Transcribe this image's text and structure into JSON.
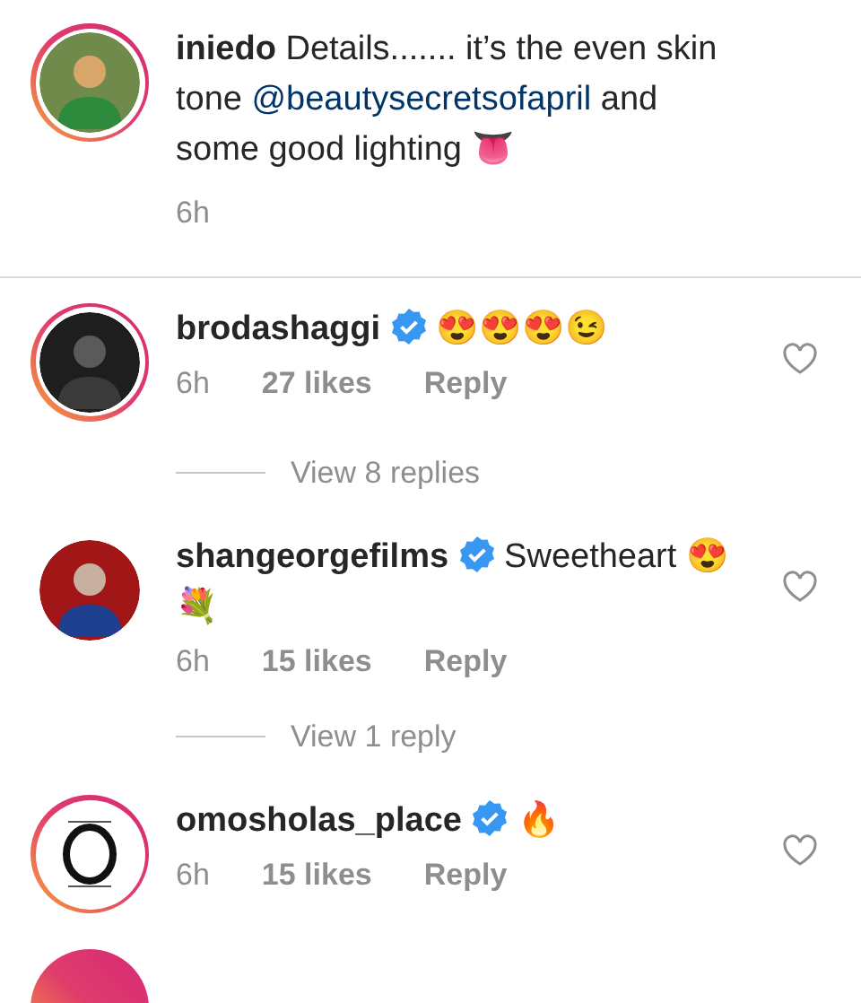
{
  "comments": [
    {
      "avatar": {
        "story_ring": true,
        "kind": "picture"
      },
      "username": "iniedo",
      "verified": false,
      "parts": [
        {
          "kind": "text",
          "text": "Details....... it’s the even skin tone"
        },
        {
          "kind": "mention",
          "text": "@beautysecretsofapril"
        },
        {
          "kind": "text",
          "text": "and some good lighting 👅"
        }
      ],
      "time": "6h",
      "divider_below": true
    },
    {
      "avatar": {
        "story_ring": true,
        "kind": "picture"
      },
      "username": "brodashaggi",
      "verified": true,
      "parts": [
        {
          "kind": "text",
          "text": "😍😍😍😉"
        }
      ],
      "time": "6h",
      "likes": "27 likes",
      "reply": "Reply",
      "view_replies": "View 8 replies"
    },
    {
      "avatar": {
        "story_ring": false,
        "kind": "picture"
      },
      "username": "shangeorgefilms",
      "verified": true,
      "parts": [
        {
          "kind": "text",
          "text": "Sweetheart 😍💐"
        }
      ],
      "time": "6h",
      "likes": "15 likes",
      "reply": "Reply",
      "view_replies": "View 1 reply"
    },
    {
      "avatar": {
        "story_ring": true,
        "kind": "logo"
      },
      "username": "omosholas_place",
      "verified": true,
      "parts": [
        {
          "kind": "text",
          "text": "🔥"
        }
      ],
      "time": "6h",
      "likes": "15 likes",
      "reply": "Reply"
    }
  ],
  "next_avatar": {
    "story_ring": true
  }
}
